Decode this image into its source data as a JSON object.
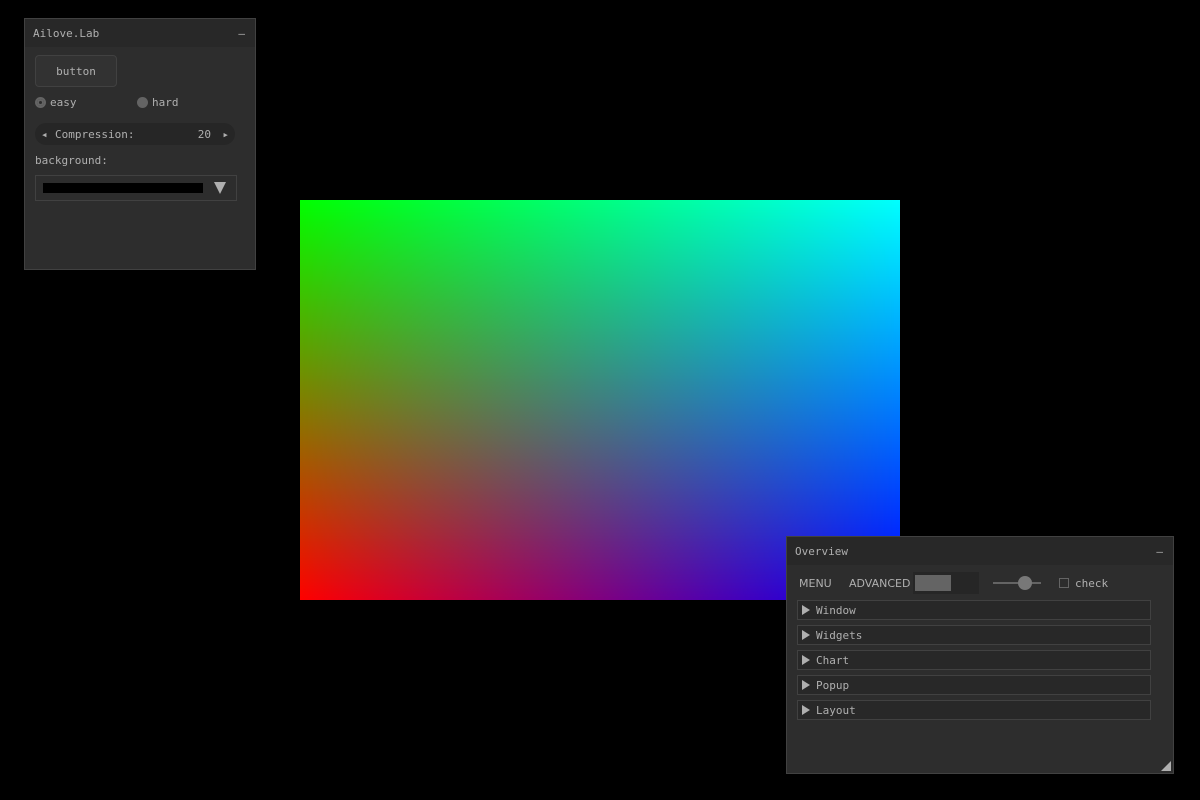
{
  "canvas": {
    "colors": {
      "top_left": "#00ff00",
      "top_right": "#00ffff",
      "bottom_left": "#ff0000",
      "bottom_right": "#0000ff"
    }
  },
  "left_panel": {
    "title": "Ailove.Lab",
    "minimize": "–",
    "button_label": "button",
    "radio_easy": "easy",
    "radio_hard": "hard",
    "selected_radio": "easy",
    "property_label": "Compression:",
    "property_value": "20",
    "property_left_arrow": "◂",
    "property_right_arrow": "▸",
    "background_label": "background:",
    "background_color": "#000000"
  },
  "overview": {
    "title": "Overview",
    "minimize": "–",
    "menu_label": "MENU",
    "advanced_label": "ADVANCED",
    "check_label": "check",
    "slider_value": 0.6,
    "nodes": [
      {
        "label": "Window"
      },
      {
        "label": "Widgets"
      },
      {
        "label": "Chart"
      },
      {
        "label": "Popup"
      },
      {
        "label": "Layout"
      }
    ]
  }
}
